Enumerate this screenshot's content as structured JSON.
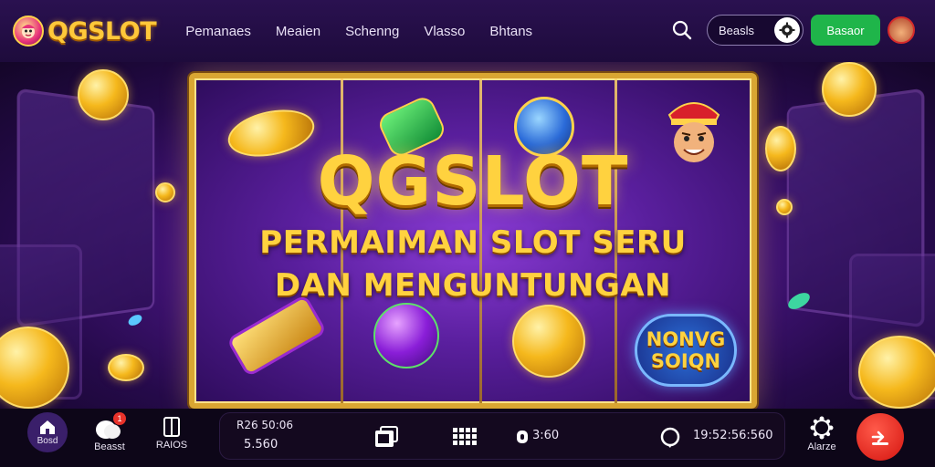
{
  "header": {
    "logo_text": "QGSLOT",
    "nav": [
      "Pemanaes",
      "Meaien",
      "Schenng",
      "Vlasso",
      "Bhtans"
    ],
    "pill_label": "Beasls",
    "green_button": "Basaor",
    "icons": [
      "search-icon",
      "settings-gear-icon",
      "user-avatar-icon"
    ]
  },
  "hero": {
    "title": "QGSLOT",
    "subtitle_line1": "PERMAIMAN SLOT SERU",
    "subtitle_line2": "DAN MENGUNTUNGAN",
    "badge_line1": "NONVG",
    "badge_line2": "SOIQN"
  },
  "bottom": {
    "home_label": "Bosd",
    "promo_label": "Beasst",
    "promo_badge": "1",
    "book_label": "RAIOS",
    "balance_label": "R26 50:06",
    "balance_value": "5.560",
    "count_value": "3:60",
    "time_value": "19:52:56:560",
    "alert_label": "Alarze",
    "icons": [
      "home-icon",
      "gift-icon",
      "book-icon",
      "copy-icon",
      "grid-icon",
      "coin-icon",
      "headset-icon",
      "gear-icon",
      "login-icon"
    ]
  },
  "colors": {
    "accent_gold": "#ffd23f",
    "bg_purple": "#1e0b3c",
    "green": "#1fb54a",
    "red": "#d4140f"
  }
}
